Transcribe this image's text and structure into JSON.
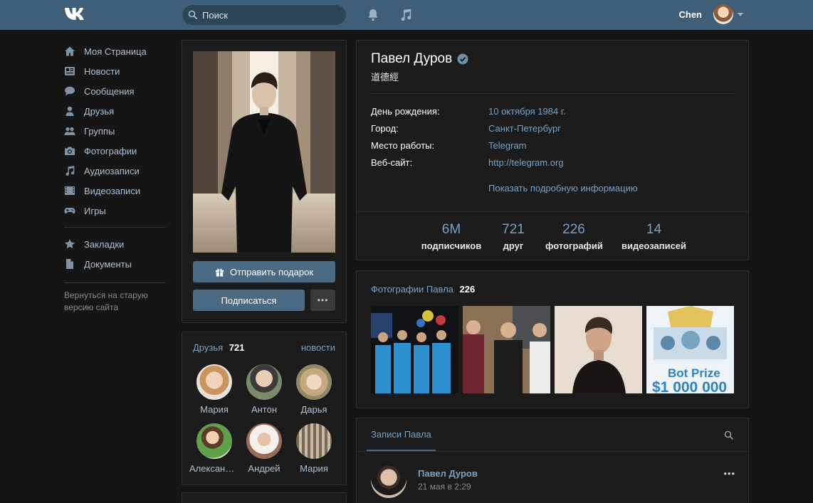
{
  "topbar": {
    "search_placeholder": "Поиск",
    "user_name": "Chen",
    "bg": "#3f5f78"
  },
  "nav": {
    "items": [
      {
        "label": "Моя Страница",
        "icon": "home-icon"
      },
      {
        "label": "Новости",
        "icon": "news-icon"
      },
      {
        "label": "Сообщения",
        "icon": "messages-icon"
      },
      {
        "label": "Друзья",
        "icon": "friends-icon"
      },
      {
        "label": "Группы",
        "icon": "groups-icon"
      },
      {
        "label": "Фотографии",
        "icon": "camera-icon"
      },
      {
        "label": "Аудиозаписи",
        "icon": "music-icon"
      },
      {
        "label": "Видеозаписи",
        "icon": "film-icon"
      },
      {
        "label": "Игры",
        "icon": "gamepad-icon"
      }
    ],
    "extra": [
      {
        "label": "Закладки",
        "icon": "star-icon"
      },
      {
        "label": "Документы",
        "icon": "document-icon"
      }
    ],
    "old_version": "Вернуться на старую версию сайта"
  },
  "profile": {
    "gift_button": "Отправить подарок",
    "subscribe_button": "Подписаться",
    "more_button": "•••",
    "name": "Павел Дуров",
    "status": "道德經",
    "info": [
      {
        "label": "День рождения:",
        "value": "10 октября 1984 г."
      },
      {
        "label": "Город:",
        "value": "Санкт-Петербург"
      },
      {
        "label": "Место работы:",
        "value": "Telegram"
      },
      {
        "label": "Веб-сайт:",
        "value": "http://telegram.org"
      }
    ],
    "show_more": "Показать подробную информацию",
    "stats": [
      {
        "num": "6M",
        "label": "подписчиков"
      },
      {
        "num": "721",
        "label": "друг"
      },
      {
        "num": "226",
        "label": "фотографий"
      },
      {
        "num": "14",
        "label": "видеозаписей"
      }
    ]
  },
  "friends": {
    "title": "Друзья",
    "count": "721",
    "news_link": "новости",
    "list": [
      {
        "name": "Мария"
      },
      {
        "name": "Антон"
      },
      {
        "name": "Дарья"
      },
      {
        "name": "Александра"
      },
      {
        "name": "Андрей"
      },
      {
        "name": "Мария"
      }
    ]
  },
  "photos": {
    "title": "Фотографии Павла",
    "count": "226"
  },
  "wall": {
    "tab": "Записи Павла",
    "post_author": "Павел Дуров",
    "post_date": "21 мая в 2:29",
    "more": "•••"
  }
}
